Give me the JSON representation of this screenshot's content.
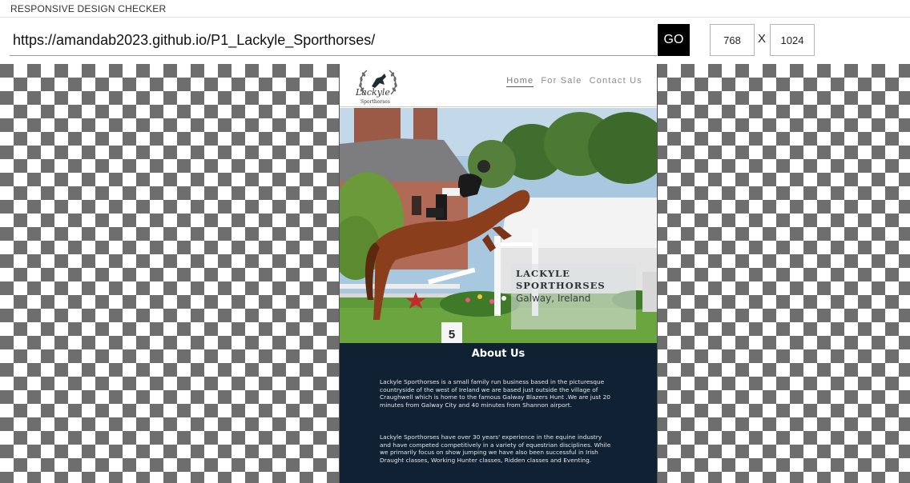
{
  "app": {
    "title": "RESPONSIVE DESIGN CHECKER"
  },
  "toolbar": {
    "url": "https://amandab2023.github.io/P1_Lackyle_Sporthorses/",
    "go_label": "GO",
    "width_value": "768",
    "separator": "X",
    "height_value": "1024"
  },
  "site": {
    "logo_script": "Lackyle",
    "logo_sub": "Sporthorses",
    "nav": [
      {
        "label": "Home",
        "active": true
      },
      {
        "label": "For Sale",
        "active": false
      },
      {
        "label": "Contact Us",
        "active": false
      }
    ],
    "hero": {
      "name_line1": "LACKYLE",
      "name_line2": "SPORTHORSES",
      "location": "Galway, Ireland",
      "fence_number": "5"
    },
    "about": {
      "title": "About Us",
      "paragraph1": "Lackyle Sporthorses is a small family run business based in the picturesque countryside of the west of Ireland we are based just outside the village of Craughwell which is home to the famous Galway Blazers Hunt .We are just 20 minutes from Galway City and 40 minutes from Shannon airport.",
      "paragraph2": "Lackyle Sporthorses have over 30 years' experience in the equine industry and have competed competitively in a variety of equestrian disciplines. While we primarily focus on show jumping we have also been successful in Irish Draught classes, Working Hunter classes, Ridden classes and Eventing."
    }
  },
  "colors": {
    "go_button": "#000000",
    "about_background": "#0f2133",
    "checker_dark": "#6e6e6e",
    "checker_light": "#ffffff"
  }
}
